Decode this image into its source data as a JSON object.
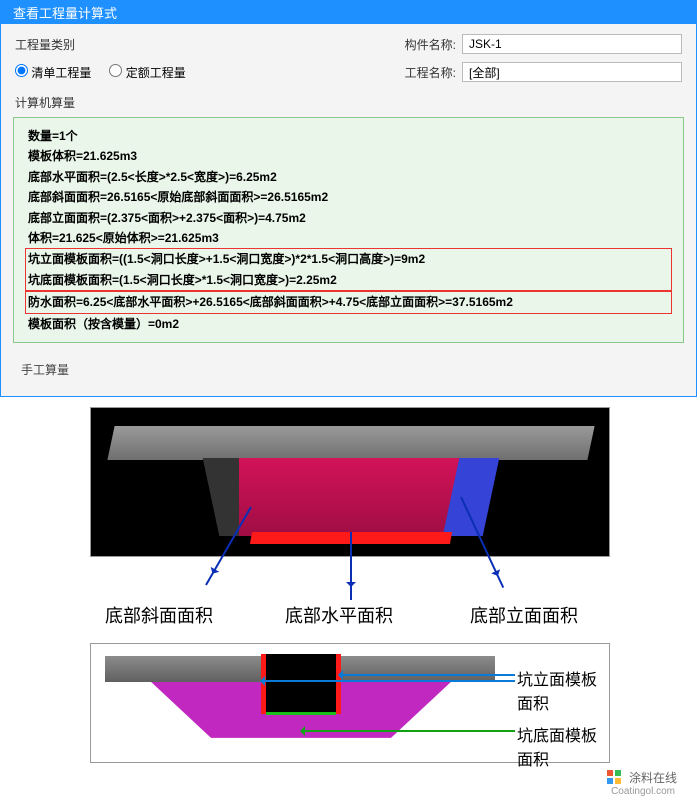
{
  "window": {
    "title": "查看工程量计算式"
  },
  "labels": {
    "qty_category": "工程量类别",
    "radio_list": "清单工程量",
    "radio_quota": "定额工程量",
    "component_name": "构件名称:",
    "project_name": "工程名称:",
    "computer_calc": "计算机算量",
    "manual_calc": "手工算量"
  },
  "inputs": {
    "component_name": "JSK-1",
    "project_name": "[全部]"
  },
  "calc": {
    "l1": "数量=1个",
    "l2": "模板体积=21.625m3",
    "l3": "底部水平面积=(2.5<长度>*2.5<宽度>)=6.25m2",
    "l4": "底部斜面面积=26.5165<原始底部斜面面积>=26.5165m2",
    "l5": "底部立面面积=(2.375<面积>+2.375<面积>)=4.75m2",
    "l6": "体积=21.625<原始体积>=21.625m3",
    "l7": "坑立面模板面积=((1.5<洞口长度>+1.5<洞口宽度>)*2*1.5<洞口高度>)=9m2",
    "l8": "坑底面模板面积=(1.5<洞口长度>*1.5<洞口宽度>)=2.25m2",
    "l9": "防水面积=6.25<底部水平面积>+26.5165<底部斜面面积>+4.75<底部立面面积>=37.5165m2",
    "l10": "模板面积（按含模量）=0m2"
  },
  "fig1_labels": {
    "a": "底部斜面面积",
    "b": "底部水平面积",
    "c": "底部立面面积"
  },
  "fig2_labels": {
    "a": "坑立面模板面积",
    "b": "坑底面模板面积"
  },
  "watermark": {
    "brand": "涂料在线",
    "url": "Coatingol.com"
  }
}
